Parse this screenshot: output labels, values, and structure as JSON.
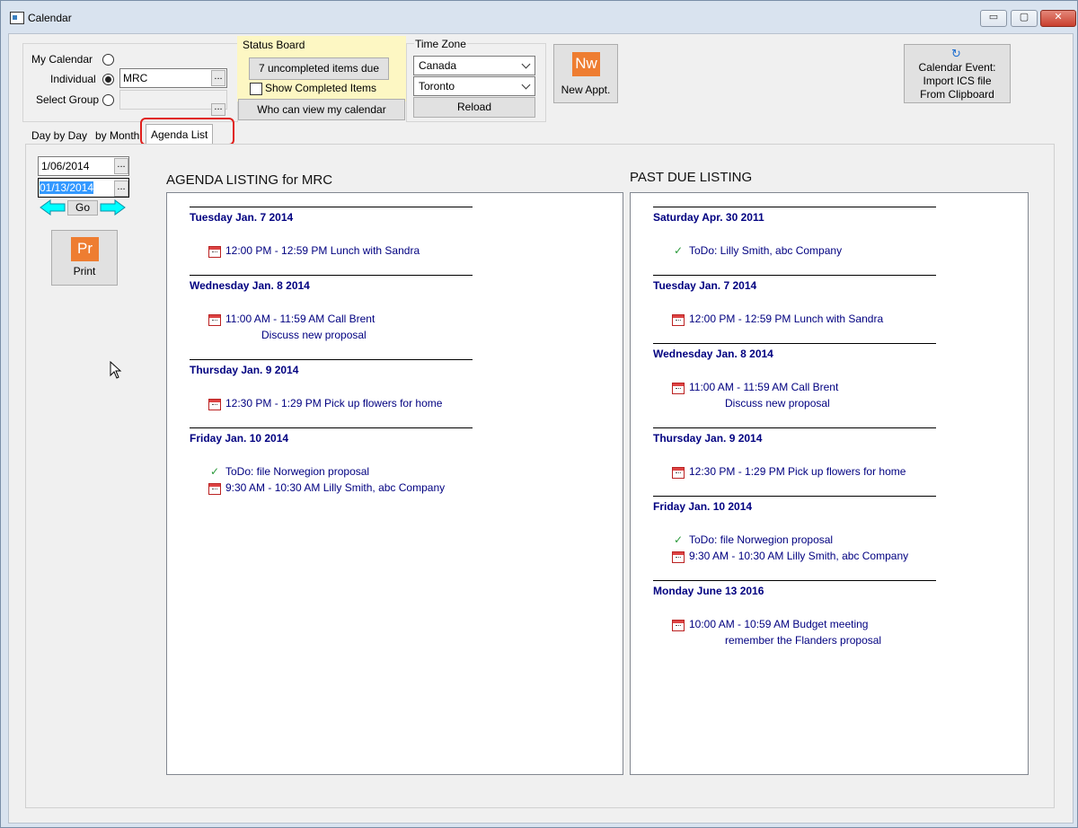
{
  "window": {
    "title": "Calendar",
    "min_label": "▭",
    "max_label": "▢",
    "close_label": "✕"
  },
  "calendar_select": {
    "my_calendar_label": "My Calendar",
    "individual_label": "Individual",
    "individual_value": "MRC",
    "select_group_label": "Select Group",
    "select_group_value": "",
    "selected": "individual"
  },
  "status_board": {
    "title": "Status Board",
    "uncompleted_button": "7 uncompleted items due",
    "show_completed_label": "Show Completed Items",
    "who_can_view_button": "Who can view my calendar"
  },
  "time_zone": {
    "title": "Time Zone",
    "region": "Canada",
    "city": "Toronto",
    "reload_button": "Reload"
  },
  "new_appt": {
    "icon_text": "Nw",
    "label": "New Appt."
  },
  "import_ics": {
    "line1": "Calendar Event:",
    "line2": "Import ICS file",
    "line3": "From Clipboard"
  },
  "tabs": {
    "day": "Day by Day",
    "month": "by Month",
    "agenda": "Agenda List",
    "active": "agenda"
  },
  "range": {
    "start": "1/06/2014",
    "end": "01/13/2014",
    "go_label": "Go"
  },
  "print": {
    "icon_text": "Pr",
    "label": "Print"
  },
  "agenda": {
    "heading": "AGENDA LISTING for MRC",
    "days": [
      {
        "date": "Tuesday Jan. 7 2014",
        "items": [
          {
            "type": "appt",
            "text": "12:00 PM - 12:59 PM Lunch with Sandra"
          }
        ]
      },
      {
        "date": "Wednesday Jan. 8 2014",
        "items": [
          {
            "type": "appt",
            "text": "11:00 AM - 11:59 AM Call Brent",
            "note": "Discuss new proposal"
          }
        ]
      },
      {
        "date": "Thursday Jan. 9 2014",
        "items": [
          {
            "type": "appt",
            "text": "12:30 PM - 1:29 PM Pick up flowers for home"
          }
        ]
      },
      {
        "date": "Friday Jan. 10 2014",
        "items": [
          {
            "type": "todo",
            "text": "ToDo:  file Norwegion proposal"
          },
          {
            "type": "appt",
            "text": "9:30 AM - 10:30 AM Lilly Smith, abc Company"
          }
        ]
      }
    ]
  },
  "past_due": {
    "heading": "PAST DUE LISTING",
    "days": [
      {
        "date": "Saturday Apr. 30 2011",
        "items": [
          {
            "type": "todo",
            "text": "ToDo:  Lilly Smith, abc Company"
          }
        ]
      },
      {
        "date": "Tuesday Jan. 7 2014",
        "items": [
          {
            "type": "appt",
            "text": "12:00 PM - 12:59 PM Lunch with Sandra"
          }
        ]
      },
      {
        "date": "Wednesday Jan. 8 2014",
        "items": [
          {
            "type": "appt",
            "text": "11:00 AM - 11:59 AM Call Brent",
            "note": "Discuss new proposal"
          }
        ]
      },
      {
        "date": "Thursday Jan. 9 2014",
        "items": [
          {
            "type": "appt",
            "text": "12:30 PM - 1:29 PM Pick up flowers for home"
          }
        ]
      },
      {
        "date": "Friday Jan. 10 2014",
        "items": [
          {
            "type": "todo",
            "text": "ToDo:  file Norwegion proposal"
          },
          {
            "type": "appt",
            "text": "9:30 AM - 10:30 AM Lilly Smith, abc Company"
          }
        ]
      },
      {
        "date": "Monday June 13 2016",
        "items": [
          {
            "type": "appt",
            "text": "10:00 AM - 10:59 AM Budget meeting",
            "note": "remember the Flanders proposal"
          }
        ]
      }
    ]
  },
  "colors": {
    "accent_orange": "#ee7d31",
    "status_board_bg": "#fdf7c3",
    "highlight_red": "#e0201c",
    "event_navy": "#000080",
    "selection_blue": "#3399ff"
  }
}
